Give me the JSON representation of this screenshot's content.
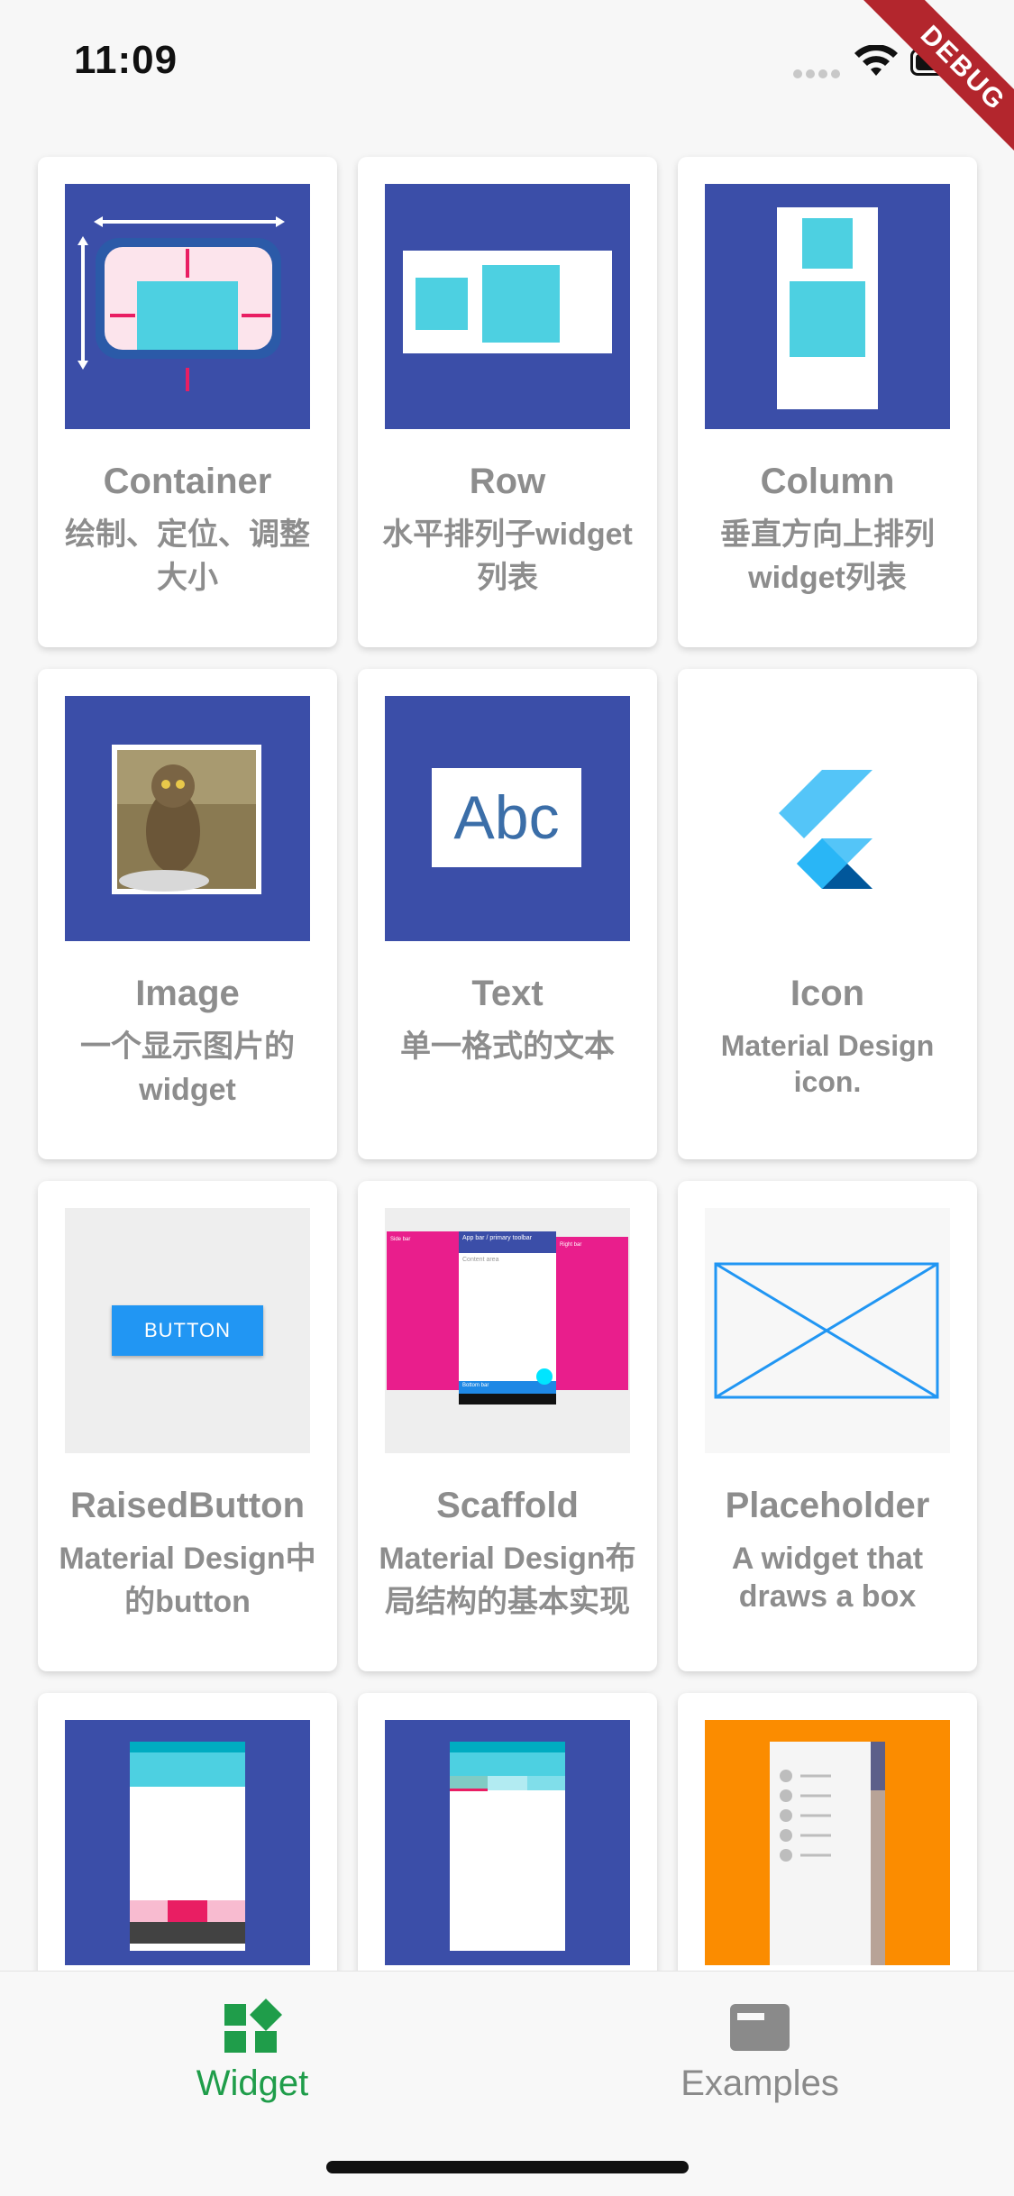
{
  "status_bar": {
    "time": "11:09",
    "debug_label": "DEBUG"
  },
  "cards": [
    {
      "title": "Container",
      "desc": "绘制、定位、调整大小"
    },
    {
      "title": "Row",
      "desc": "水平排列子widget 列表"
    },
    {
      "title": "Column",
      "desc": "垂直方向上排列widget列表"
    },
    {
      "title": "Image",
      "desc": "一个显示图片的widget"
    },
    {
      "title": "Text",
      "desc": "单一格式的文本"
    },
    {
      "title": "Icon",
      "desc": "Material Design icon."
    },
    {
      "title": "RaisedButton",
      "desc": "Material Design中的button"
    },
    {
      "title": "Scaffold",
      "desc": "Material Design布局结构的基本实现"
    },
    {
      "title": "Placeholder",
      "desc": "A widget that draws a box"
    },
    {
      "title": "",
      "desc": ""
    },
    {
      "title": "",
      "desc": ""
    },
    {
      "title": "",
      "desc": ""
    }
  ],
  "thumb_texts": {
    "text_sample": "Abc",
    "button_label": "BUTTON",
    "scaffold_appbar": "App bar / primary toolbar",
    "scaffold_content": "Content area",
    "scaffold_left": "Side bar",
    "scaffold_right": "Right bar",
    "scaffold_bottom": "Bottom bar"
  },
  "bottom_nav": {
    "items": [
      {
        "label": "Widget",
        "icon": "dashboard-icon",
        "selected": true
      },
      {
        "label": "Examples",
        "icon": "web-icon",
        "selected": false
      }
    ]
  },
  "colors": {
    "indigo": "#3b4ea8",
    "cyan": "#4dd0e1",
    "pink": "#e91e63",
    "accent_green": "#1f9d4a",
    "orange": "#fb8c00",
    "blue_button": "#2196f3"
  }
}
